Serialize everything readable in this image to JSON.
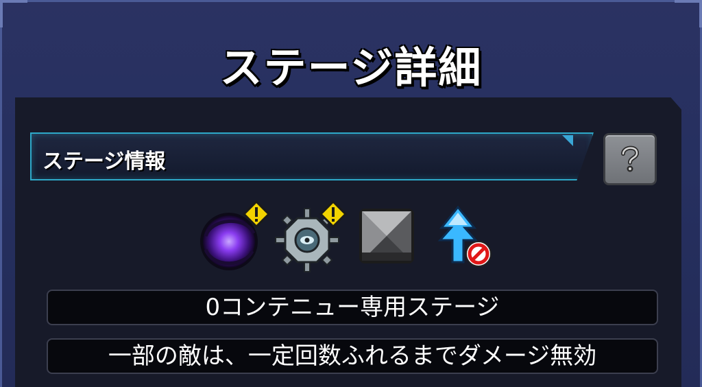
{
  "header": {
    "title": "ステージ詳細"
  },
  "info_section": {
    "label": "ステージ情報",
    "help_icon": "help-question-icon"
  },
  "gimmicks": [
    {
      "icon": "black-hole-icon",
      "warning": true
    },
    {
      "icon": "damage-wall-mine-icon",
      "warning": true
    },
    {
      "icon": "block-icon",
      "warning": false
    },
    {
      "icon": "speed-up-prohibited-icon",
      "warning": false
    }
  ],
  "notes": {
    "line1": "0コンテニュー専用ステージ",
    "line2": "一部の敵は、一定回数ふれるまでダメージ無効"
  },
  "colors": {
    "accent": "#2ea9c9",
    "warning": "#f2d300",
    "background": "#263060"
  }
}
